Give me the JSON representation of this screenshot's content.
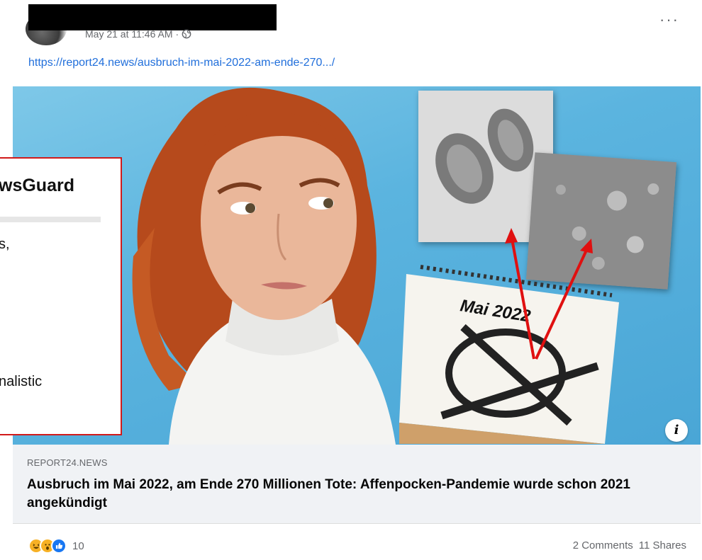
{
  "post": {
    "timestamp": "May 21 at 11:46 AM",
    "privacy_icon": "globe-icon",
    "more_icon": "more-options-icon",
    "link_text": "https://report24.news/ausbruch-im-mai-2022-am-ende-270.../"
  },
  "image": {
    "calendar_text": "Mai 2022"
  },
  "link_preview": {
    "domain": "REPORT24.NEWS",
    "headline": "Ausbruch im Mai 2022, am Ende 270 Millionen Tote: Affenpocken-Pandemie wurde schon 2021 angekündigt"
  },
  "engagement": {
    "reaction_count": "10",
    "comments": "2 Comments",
    "shares": "11 Shares"
  },
  "newsguard": {
    "title": "wsGuard",
    "line1": "s,",
    "line2": "nalistic"
  },
  "colors": {
    "link": "#216fdb",
    "overlay_border": "#d11a1a",
    "like_blue": "#1877f2"
  }
}
